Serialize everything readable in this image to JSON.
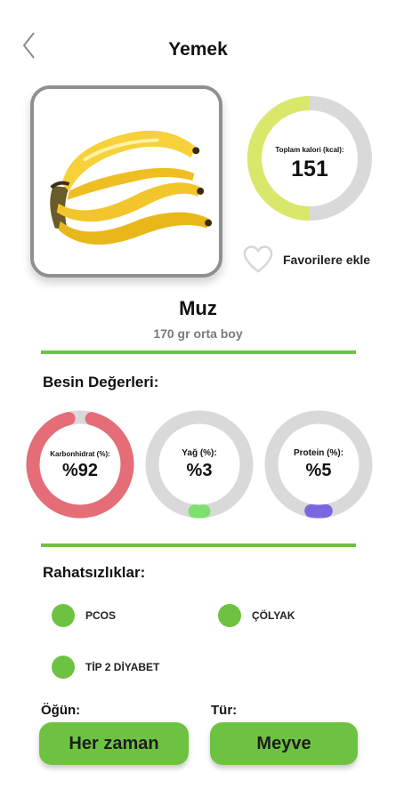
{
  "header": {
    "title": "Yemek",
    "back_icon": "chevron-left-icon"
  },
  "calories": {
    "label": "Toplam kalori (kcal):",
    "value": "151",
    "fraction": 0.5,
    "color": "#d9e86a",
    "track_color": "#d9d9d9"
  },
  "favorite": {
    "label": "Favorilere ekle",
    "icon": "heart-icon"
  },
  "food": {
    "name": "Muz",
    "portion": "170 gr orta boy",
    "image": "banana-bunch"
  },
  "nutrition": {
    "title": "Besin Değerleri:",
    "items": [
      {
        "label": "Karbonhidrat (%):",
        "value": "%92",
        "percent": 92,
        "color": "#e46d78"
      },
      {
        "label": "Yağ (%):",
        "value": "%3",
        "percent": 3,
        "color": "#7de06f"
      },
      {
        "label": "Protein (%):",
        "value": "%5",
        "percent": 5,
        "color": "#7a67e0"
      }
    ],
    "track_color": "#d9d9d9"
  },
  "conditions": {
    "title": "Rahatsızlıklar:",
    "items": [
      "PCOS",
      "ÇÖLYAK",
      "TİP 2 DİYABET"
    ],
    "dot_color": "#6dc341"
  },
  "fields": {
    "meal_label": "Öğün:",
    "meal_value": "Her zaman",
    "type_label": "Tür:",
    "type_value": "Meyve"
  },
  "accent_color": "#6dc341"
}
